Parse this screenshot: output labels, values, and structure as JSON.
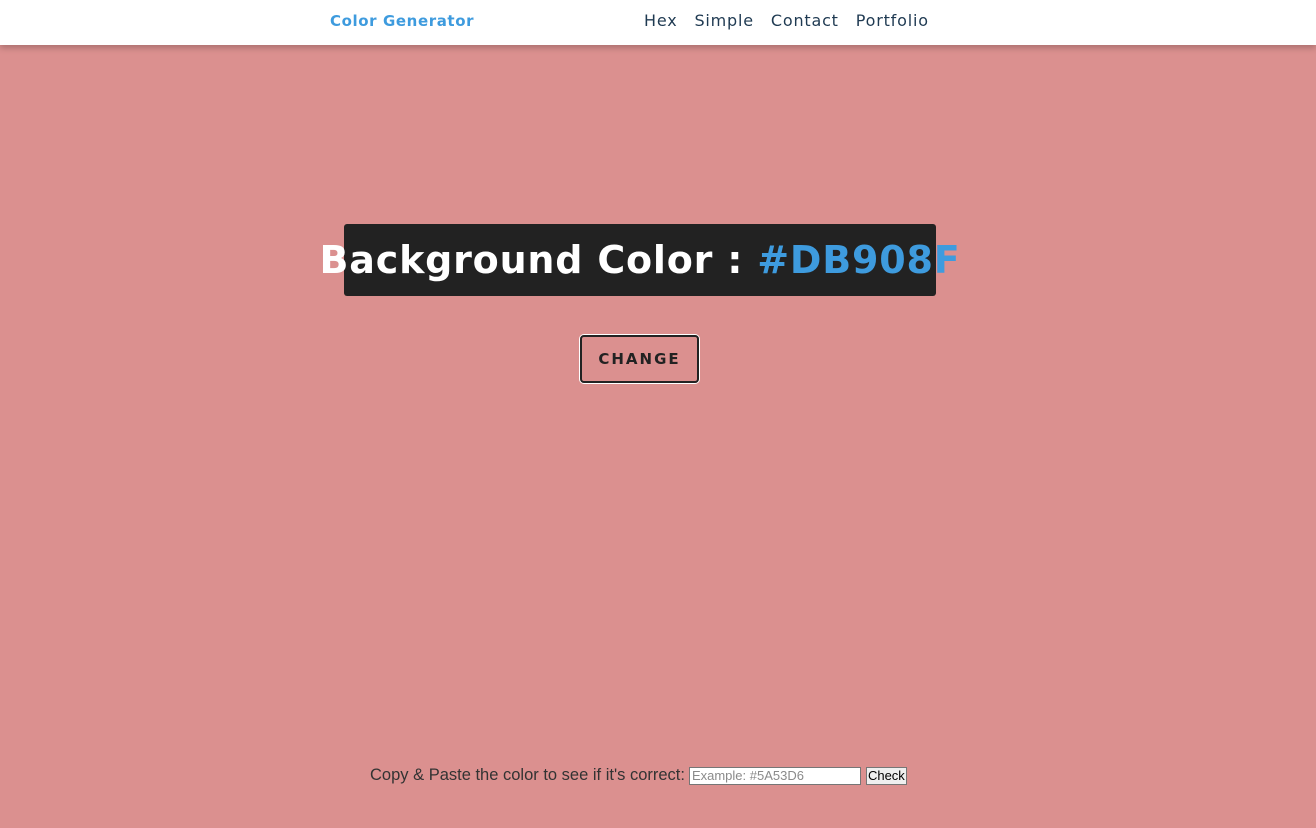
{
  "navbar": {
    "brand": "Color Generator",
    "links": [
      {
        "label": "Hex"
      },
      {
        "label": "Simple"
      },
      {
        "label": "Contact"
      },
      {
        "label": "Portfolio"
      }
    ]
  },
  "main": {
    "heading_prefix": "Background Color : ",
    "color_value": "#DB908F",
    "change_button_label": "CHANGE"
  },
  "check": {
    "label": "Copy & Paste the color to see if it's correct:",
    "input_value": "",
    "input_placeholder": "Example: #5A53D6",
    "button_label": "Check"
  },
  "colors": {
    "background": "#DB908F",
    "accent": "#3E9BDE",
    "heading_box": "#222222",
    "navbar": "#FFFFFF"
  }
}
